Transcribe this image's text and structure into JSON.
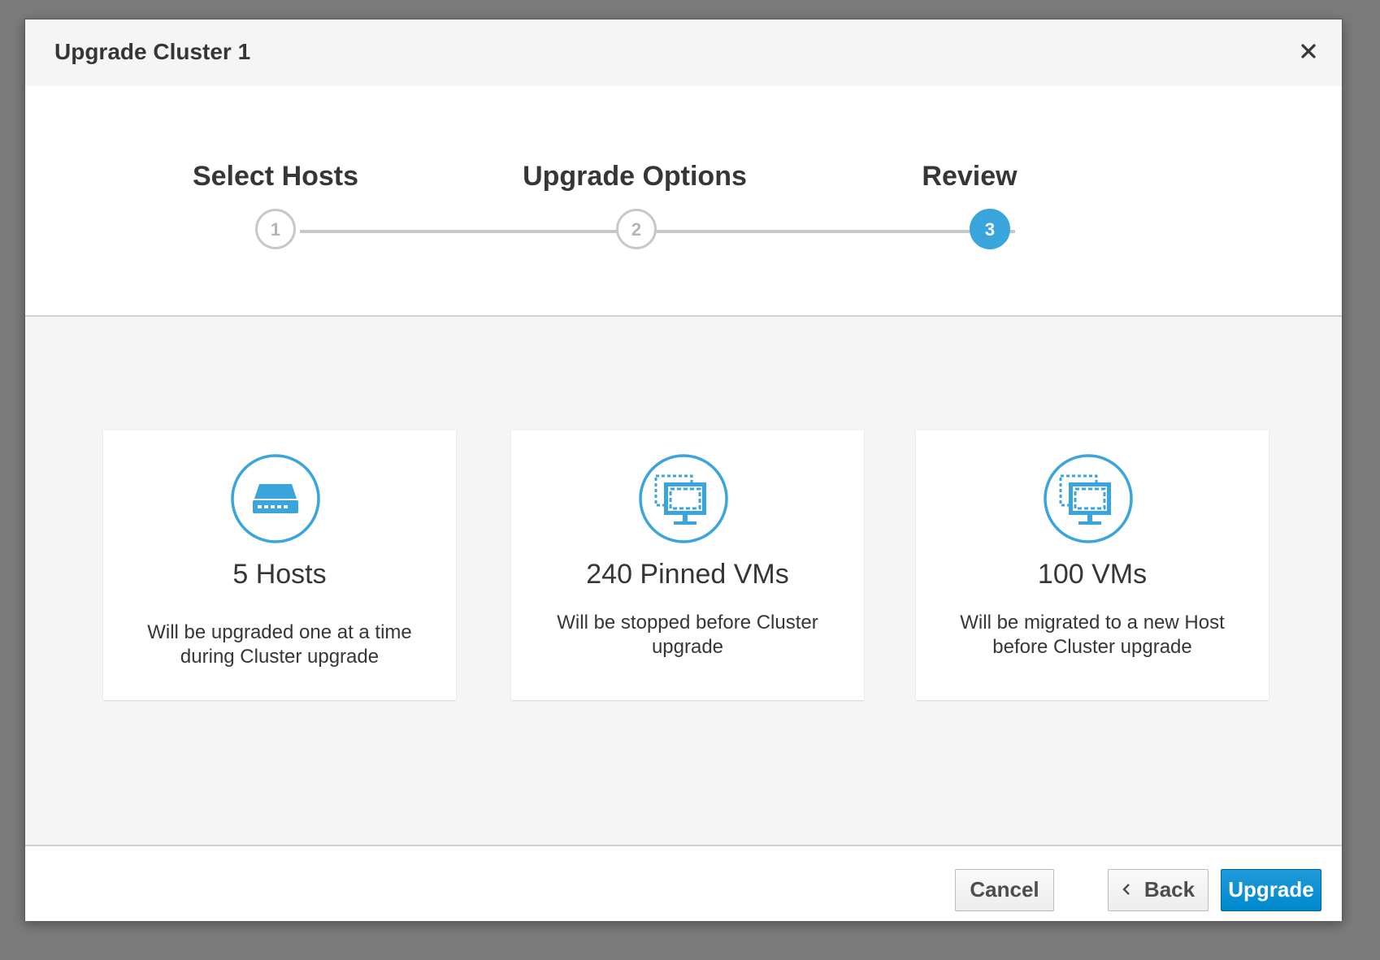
{
  "dialog": {
    "title": "Upgrade Cluster 1",
    "close_icon": "close-icon"
  },
  "wizard": {
    "steps": [
      {
        "label": "Select Hosts",
        "number": "1",
        "state": "complete"
      },
      {
        "label": "Upgrade Options",
        "number": "2",
        "state": "complete"
      },
      {
        "label": "Review",
        "number": "3",
        "state": "active"
      }
    ]
  },
  "summary": {
    "cards": [
      {
        "icon": "server-icon",
        "title": "5 Hosts",
        "description": "Will be upgraded one at a time during Cluster upgrade"
      },
      {
        "icon": "virtual-machine-icon",
        "title": "240 Pinned VMs",
        "description": "Will be stopped before Cluster upgrade"
      },
      {
        "icon": "virtual-machine-icon",
        "title": "100 VMs",
        "description": "Will be migrated to a new Host before Cluster upgrade"
      }
    ]
  },
  "footer": {
    "cancel_label": "Cancel",
    "back_label": "Back",
    "back_icon": "chevron-left-icon",
    "upgrade_label": "Upgrade"
  },
  "colors": {
    "accent": "#39a5dc",
    "primary_button": "#0088ce",
    "backdrop": "#7b7b7b"
  }
}
